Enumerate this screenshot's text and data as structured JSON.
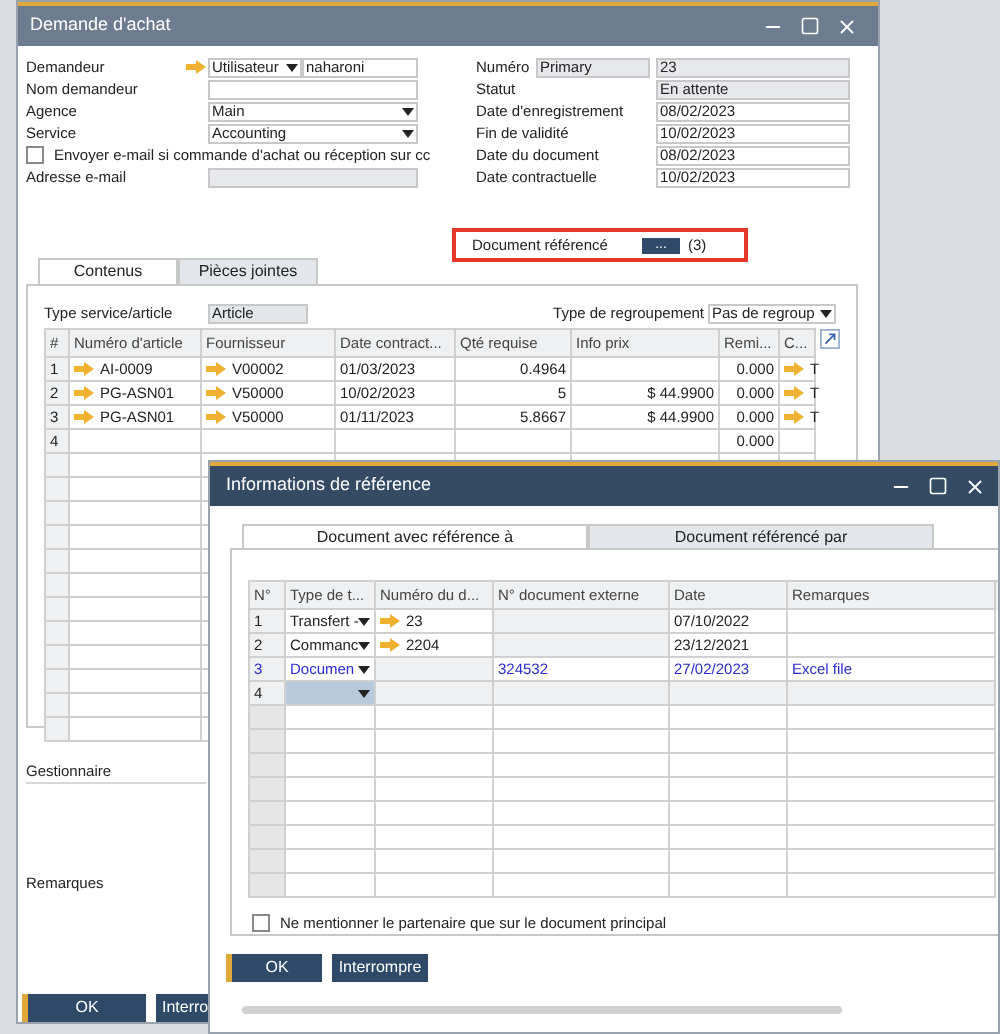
{
  "main_window": {
    "title": "Demande d'achat",
    "left_fields": [
      {
        "label": "Demandeur",
        "kind": "user",
        "select": "Utilisateur",
        "value": "naharoni"
      },
      {
        "label": "Nom demandeur",
        "kind": "text"
      },
      {
        "label": "Agence",
        "kind": "select",
        "value": "Main"
      },
      {
        "label": "Service",
        "kind": "select",
        "value": "Accounting"
      },
      {
        "label": "Envoyer e-mail si commande d'achat ou réception sur cc",
        "kind": "checkbox",
        "checked": false
      },
      {
        "label": "Adresse e-mail",
        "kind": "disabled"
      }
    ],
    "right_fields": [
      {
        "label": "Numéro",
        "series": "Primary",
        "value": "23",
        "disabled": true
      },
      {
        "label": "Statut",
        "value": "En attente",
        "disabled": true
      },
      {
        "label": "Date d'enregistrement",
        "value": "08/02/2023",
        "disabled": false
      },
      {
        "label": "Fin de validité",
        "value": "10/02/2023",
        "disabled": false
      },
      {
        "label": "Date du document",
        "value": "08/02/2023",
        "disabled": false
      },
      {
        "label": "Date contractuelle",
        "value": "10/02/2023",
        "disabled": false
      }
    ],
    "referenced_document": {
      "label": "Document référencé",
      "button": "...",
      "count": "(3)"
    },
    "tabs": [
      {
        "label": "Contenus",
        "selected": true
      },
      {
        "label": "Pièces jointes",
        "selected": false
      }
    ],
    "item_type": {
      "label": "Type service/article",
      "value": "Article"
    },
    "grouping": {
      "label": "Type de regroupement",
      "value": "Pas de regroup"
    },
    "table": {
      "columns": [
        "#",
        "Numéro d'article",
        "Fournisseur",
        "Date contract...",
        "Qté requise",
        "Info prix",
        "Remi...",
        "C..."
      ],
      "rows": [
        {
          "no": "1",
          "item": "AI-0009",
          "vendor": "V00002",
          "date": "01/03/2023",
          "qty": "0.4964",
          "discount": "0.000",
          "c": "T"
        },
        {
          "no": "2",
          "item": "PG-ASN01",
          "vendor": "V50000",
          "date": "10/02/2023",
          "qty": "5",
          "price": "$ 44.9900",
          "discount": "0.000",
          "c": "T"
        },
        {
          "no": "3",
          "item": "PG-ASN01",
          "vendor": "V50000",
          "date": "01/11/2023",
          "qty": "5.8667",
          "price": "$ 44.9900",
          "discount": "0.000",
          "c": "T"
        },
        {
          "no": "4",
          "discount": "0.000"
        }
      ]
    },
    "manager_label": "Gestionnaire",
    "remarks_label": "Remarques",
    "buttons": [
      "OK",
      "Interro"
    ]
  },
  "reference_dialog": {
    "title": "Informations de référence",
    "tabs": [
      {
        "label": "Document avec référence à",
        "selected": true
      },
      {
        "label": "Document référencé par",
        "selected": false
      }
    ],
    "columns": [
      "N°",
      "Type de t...",
      "Numéro du d...",
      "N° document externe",
      "Date",
      "Remarques"
    ],
    "rows": [
      {
        "no": "1",
        "kind": "linked",
        "type": "Transfert -",
        "doc_no": "23",
        "date": "07/10/2022",
        "selected": false
      },
      {
        "no": "2",
        "kind": "linked",
        "type": "Commanc",
        "doc_no": "2204",
        "date": "23/12/2021",
        "selected": false
      },
      {
        "no": "3",
        "kind": "manual",
        "type": "Documen",
        "external_no": "324532",
        "date": "27/02/2023",
        "remarks": "Excel file",
        "selected": false
      },
      {
        "no": "4",
        "kind": "new",
        "selected": true
      }
    ],
    "checkbox": {
      "label": "Ne mentionner le partenaire que sur le document principal",
      "checked": false
    },
    "buttons": [
      "OK",
      "Interrompre"
    ]
  }
}
